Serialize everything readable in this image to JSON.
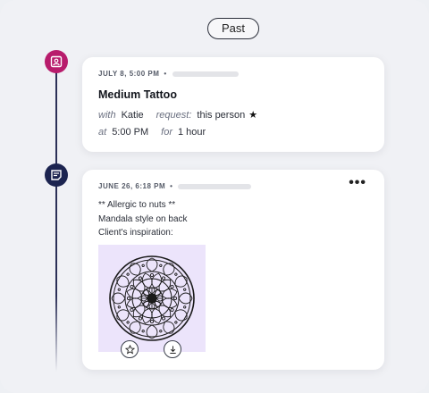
{
  "filter": {
    "label": "Past"
  },
  "appointment": {
    "date_time": "JULY 8, 5:00 PM",
    "separator": "•",
    "title": "Medium Tattoo",
    "with_label": "with",
    "artist": "Katie",
    "request_label": "request:",
    "request_value": "this person",
    "request_icon": "star-icon",
    "at_label": "at",
    "time": "5:00 PM",
    "for_label": "for",
    "duration": "1 hour",
    "node_icon": "calendar-person-icon",
    "node_color": "#b81c6c"
  },
  "note": {
    "date_time": "JUNE 26, 6:18 PM",
    "separator": "•",
    "menu_icon": "more-dots-icon",
    "menu_label": "•••",
    "lines": [
      "** Allergic to nuts **",
      "Mandala style on back",
      "Client's inspiration:"
    ],
    "image": {
      "description_icon": "mandala-image",
      "background": "#ece4fb"
    },
    "actions": [
      {
        "icon": "star-outline-icon"
      },
      {
        "icon": "download-icon"
      }
    ],
    "node_icon": "note-icon",
    "node_color": "#1c2450"
  },
  "colors": {
    "timeline": "#2c3057",
    "page_bg": "#f0f1f5",
    "card_bg": "#ffffff"
  }
}
